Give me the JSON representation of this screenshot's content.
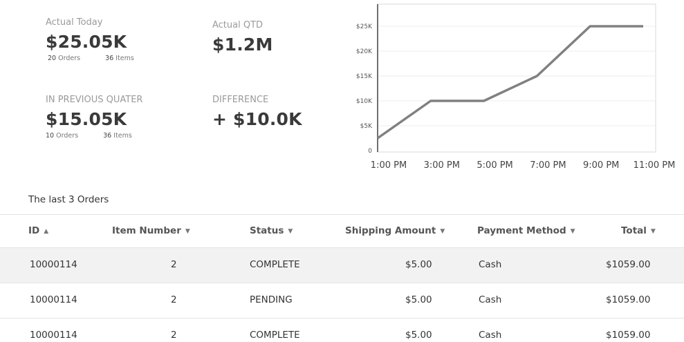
{
  "stats": {
    "actual_today": {
      "label": "Actual Today",
      "value": "$25.05K",
      "orders_count": "20",
      "orders_label": "Orders",
      "items_count": "36",
      "items_label": "Items"
    },
    "actual_qtd": {
      "label": "Actual QTD",
      "value": "$1.2M"
    },
    "previous_quarter": {
      "label": "IN PREVIOUS QUATER",
      "value": "$15.05K",
      "orders_count": "10",
      "orders_label": "Orders",
      "items_count": "36",
      "items_label": "Items"
    },
    "difference": {
      "label": "DIFFERENCE",
      "value": "+ $10.0K"
    }
  },
  "chart_data": {
    "type": "line",
    "x": [
      "1:00 PM",
      "3:00 PM",
      "5:00 PM",
      "7:00 PM",
      "9:00 PM",
      "11:00 PM"
    ],
    "series": [
      {
        "values": [
          2500,
          10000,
          10000,
          15000,
          25000,
          25000
        ]
      }
    ],
    "yticks": [
      "0",
      "$5K",
      "$10K",
      "$15K",
      "$20K",
      "$25K"
    ],
    "ylim": [
      0,
      25000
    ],
    "grid": true,
    "line_color": "#808080"
  },
  "orders": {
    "title": "The last 3 Orders",
    "columns": [
      {
        "label": "ID",
        "sort": "▲"
      },
      {
        "label": "Item Number",
        "sort": "▼"
      },
      {
        "label": "Status",
        "sort": "▼"
      },
      {
        "label": "Shipping Amount",
        "sort": "▼"
      },
      {
        "label": "Payment Method",
        "sort": "▼"
      },
      {
        "label": "Total",
        "sort": "▼"
      }
    ],
    "rows": [
      {
        "id": "10000114",
        "item_number": "2",
        "status": "COMPLETE",
        "shipping": "$5.00",
        "payment": "Cash",
        "total": "$1059.00"
      },
      {
        "id": "10000114",
        "item_number": "2",
        "status": "PENDING",
        "shipping": "$5.00",
        "payment": "Cash",
        "total": "$1059.00"
      },
      {
        "id": "10000114",
        "item_number": "2",
        "status": "COMPLETE",
        "shipping": "$5.00",
        "payment": "Cash",
        "total": "$1059.00"
      }
    ]
  }
}
